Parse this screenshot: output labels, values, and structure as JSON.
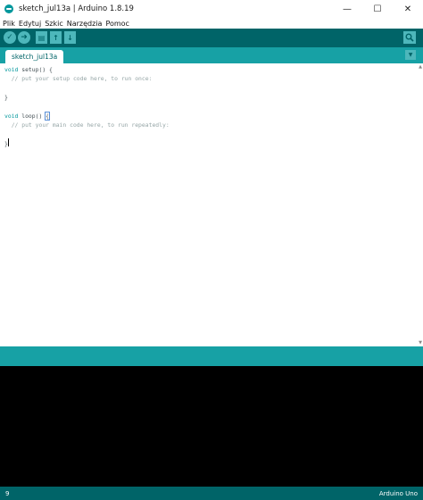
{
  "window": {
    "title": "sketch_jul13a | Arduino 1.8.19",
    "minimize": "—",
    "maximize": "☐",
    "close": "✕"
  },
  "menu": [
    "Plik",
    "Edytuj",
    "Szkic",
    "Narzędzia",
    "Pomoc"
  ],
  "toolbar": {
    "verify_icon": "✓",
    "upload_icon": "➜",
    "new_icon": "▤",
    "open_icon": "↑",
    "save_icon": "↓",
    "search_icon": "search-icon"
  },
  "tabs": [
    {
      "label": "sketch_jul13a"
    }
  ],
  "tab_menu_icon": "▼",
  "editor": {
    "l1_kw": "void",
    "l1_rest": " setup() {",
    "l2": "  // put your setup code here, to run once:",
    "l4": "}",
    "l6_kw": "void",
    "l6_rest": " loop() ",
    "l6_brace": "{",
    "l7": "  // put your main code here, to run repeatedly:",
    "l9": "}"
  },
  "status": {
    "line_number": "9",
    "board": "Arduino Uno"
  },
  "colors": {
    "teal_dark": "#006468",
    "teal_mid": "#17a1a5",
    "teal_light": "#4db7bb",
    "keyword": "#00979c"
  }
}
